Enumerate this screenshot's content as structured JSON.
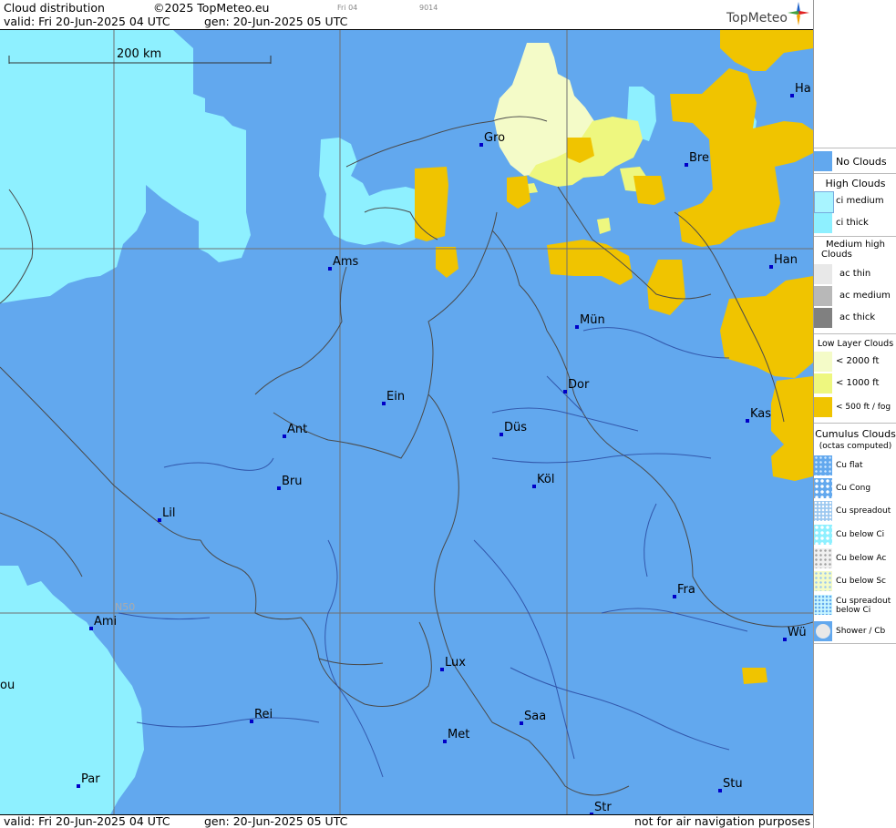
{
  "header": {
    "title": "Cloud distribution",
    "copyright": "©2025 TopMeteo.eu",
    "small_day": "Fri 04",
    "small_code": "9014",
    "valid": "valid:  Fri  20-Jun-2025  04 UTC",
    "gen": "gen: 20-Jun-2025 05 UTC",
    "logo": "TopMeteo"
  },
  "map": {
    "scale_label": "200 km",
    "grid_label": "N50",
    "cities": [
      {
        "name": "Gro"
      },
      {
        "name": "Bre"
      },
      {
        "name": "Ha"
      },
      {
        "name": "Ams"
      },
      {
        "name": "Han"
      },
      {
        "name": "Mün"
      },
      {
        "name": "Dor"
      },
      {
        "name": "Ein"
      },
      {
        "name": "Ant"
      },
      {
        "name": "Düs"
      },
      {
        "name": "Kas"
      },
      {
        "name": "Bru"
      },
      {
        "name": "Köl"
      },
      {
        "name": "Lil"
      },
      {
        "name": "Fra"
      },
      {
        "name": "Ami"
      },
      {
        "name": "Wü"
      },
      {
        "name": "Lux"
      },
      {
        "name": "Rei"
      },
      {
        "name": "Saa"
      },
      {
        "name": "Met"
      },
      {
        "name": "ou"
      },
      {
        "name": "Par"
      },
      {
        "name": "Stu"
      },
      {
        "name": "Str"
      }
    ],
    "colors": {
      "no_clouds": "#62a8ee",
      "ci": "#8ef0ff",
      "low_2000": "#f4fbc8",
      "low_1000": "#eef77f",
      "low_500": "#f0c400"
    }
  },
  "footer": {
    "valid": "valid:  Fri  20-Jun-2025  04 UTC",
    "gen": "gen: 20-Jun-2025 05 UTC",
    "note": "not for air navigation purposes"
  },
  "legend": {
    "no_clouds": "No Clouds",
    "high_head": "High Clouds",
    "ci_medium": "ci medium",
    "ci_thick": "ci thick",
    "medium_head_1": "Medium high",
    "medium_head_2": "Clouds",
    "ac_thin": "ac thin",
    "ac_medium": "ac medium",
    "ac_thick": "ac thick",
    "low_head": "Low Layer Clouds",
    "low_2000": "< 2000 ft",
    "low_1000": "< 1000 ft",
    "low_500": "< 500 ft / fog",
    "cu_head": "Cumulus Clouds",
    "cu_sub": "(octas computed)",
    "cu_flat": "Cu flat",
    "cu_cong": "Cu Cong",
    "cu_spreadout": "Cu spreadout",
    "cu_below_ci": "Cu below Ci",
    "cu_below_ac": "Cu below Ac",
    "cu_below_sc": "Cu below Sc",
    "cu_spread_ci_1": "Cu spreadout",
    "cu_spread_ci_2": "below Ci",
    "shower": "Shower / Cb"
  }
}
